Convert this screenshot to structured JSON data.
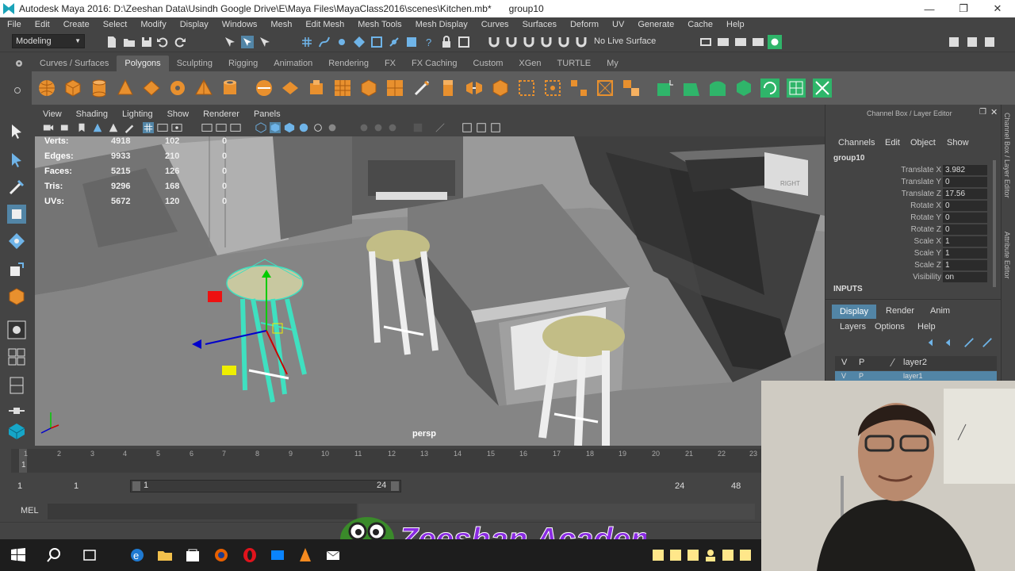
{
  "window": {
    "title": "Autodesk Maya 2016: D:\\Zeeshan Data\\Usindh Google Drive\\E\\Maya Files\\MayaClass2016\\scenes\\Kitchen.mb*",
    "selection": "group10"
  },
  "menus": [
    "File",
    "Edit",
    "Create",
    "Select",
    "Modify",
    "Display",
    "Windows",
    "Mesh",
    "Edit Mesh",
    "Mesh Tools",
    "Mesh Display",
    "Curves",
    "Surfaces",
    "Deform",
    "UV",
    "Generate",
    "Cache",
    "Help"
  ],
  "status": {
    "mode": "Modeling",
    "live_surface": "No Live Surface"
  },
  "shelf_tabs": [
    "Curves / Surfaces",
    "Polygons",
    "Sculpting",
    "Rigging",
    "Animation",
    "Rendering",
    "FX",
    "FX Caching",
    "Custom",
    "XGen",
    "TURTLE",
    "My"
  ],
  "active_shelf": "Polygons",
  "viewport": {
    "menu": [
      "View",
      "Shading",
      "Lighting",
      "Show",
      "Renderer",
      "Panels"
    ],
    "camera_label": "persp",
    "hud": [
      {
        "label": "Verts:",
        "a": "4918",
        "b": "102",
        "c": "0"
      },
      {
        "label": "Edges:",
        "a": "9933",
        "b": "210",
        "c": "0"
      },
      {
        "label": "Faces:",
        "a": "5215",
        "b": "126",
        "c": "0"
      },
      {
        "label": "Tris:",
        "a": "9296",
        "b": "168",
        "c": "0"
      },
      {
        "label": "UVs:",
        "a": "5672",
        "b": "120",
        "c": "0"
      }
    ],
    "cube_label": "RIGHT"
  },
  "channel_box": {
    "header": "Channel Box / Layer Editor",
    "menu": [
      "Channels",
      "Edit",
      "Object",
      "Show"
    ],
    "object": "group10",
    "attributes": [
      {
        "name": "Translate X",
        "value": "3.982"
      },
      {
        "name": "Translate Y",
        "value": "0"
      },
      {
        "name": "Translate Z",
        "value": "17.56"
      },
      {
        "name": "Rotate X",
        "value": "0"
      },
      {
        "name": "Rotate Y",
        "value": "0"
      },
      {
        "name": "Rotate Z",
        "value": "0"
      },
      {
        "name": "Scale X",
        "value": "1"
      },
      {
        "name": "Scale Y",
        "value": "1"
      },
      {
        "name": "Scale Z",
        "value": "1"
      },
      {
        "name": "Visibility",
        "value": "on"
      }
    ],
    "inputs_label": "INPUTS",
    "layer_tabs": [
      "Display",
      "Render",
      "Anim"
    ],
    "layer_menu": [
      "Layers",
      "Options",
      "Help"
    ],
    "layers": [
      {
        "v": "V",
        "p": "P",
        "name": "layer2"
      },
      {
        "v": "V",
        "p": "P",
        "name": "layer1"
      }
    ],
    "side_labels": [
      "Channel Box / Layer Editor",
      "Attribute Editor"
    ]
  },
  "timeline": {
    "ticks": [
      "1",
      "2",
      "3",
      "4",
      "5",
      "6",
      "7",
      "8",
      "9",
      "10",
      "11",
      "12",
      "13",
      "14",
      "15",
      "16",
      "17",
      "18",
      "19",
      "20",
      "21",
      "22",
      "23"
    ],
    "current_frame": "1"
  },
  "range": {
    "start": "1",
    "playback_start": "1",
    "range_start": "1",
    "range_end": "24",
    "playback_end": "24",
    "end": "48"
  },
  "command_line": {
    "lang": "MEL"
  },
  "watermark": "Zeeshan Academy",
  "colors": {
    "maya_bg": "#444444",
    "shelf": "#5d5d5d",
    "viewport": "#8c8c8c",
    "select_blue": "#5285a6",
    "shelf_orange": "#e8902e",
    "shelf_green": "#2fb56a",
    "watermark_purple": "#8a2be2"
  }
}
